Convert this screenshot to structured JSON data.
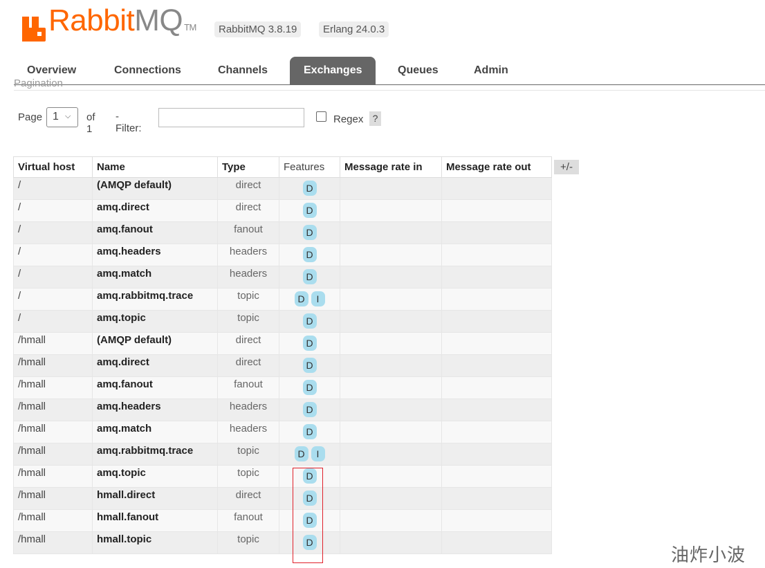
{
  "header": {
    "logo_rabbit": "Rabbit",
    "logo_mq": "MQ",
    "logo_tm": "TM",
    "version_badge": "RabbitMQ 3.8.19",
    "erlang_badge": "Erlang 24.0.3"
  },
  "tabs": [
    "Overview",
    "Connections",
    "Channels",
    "Exchanges",
    "Queues",
    "Admin"
  ],
  "active_tab": "Exchanges",
  "pagination": {
    "section_label": "Pagination",
    "page_label": "Page",
    "page_value": "1",
    "of_label": "of 1",
    "filter_label": "- Filter:",
    "filter_value": "",
    "regex_label": "Regex",
    "help_label": "?"
  },
  "table": {
    "columns": [
      "Virtual host",
      "Name",
      "Type",
      "Features",
      "Message rate in",
      "Message rate out"
    ],
    "toggle_label": "+/-",
    "rows": [
      {
        "vhost": "/",
        "name": "(AMQP default)",
        "type": "direct",
        "features": [
          "D"
        ]
      },
      {
        "vhost": "/",
        "name": "amq.direct",
        "type": "direct",
        "features": [
          "D"
        ]
      },
      {
        "vhost": "/",
        "name": "amq.fanout",
        "type": "fanout",
        "features": [
          "D"
        ]
      },
      {
        "vhost": "/",
        "name": "amq.headers",
        "type": "headers",
        "features": [
          "D"
        ]
      },
      {
        "vhost": "/",
        "name": "amq.match",
        "type": "headers",
        "features": [
          "D"
        ]
      },
      {
        "vhost": "/",
        "name": "amq.rabbitmq.trace",
        "type": "topic",
        "features": [
          "D",
          "I"
        ]
      },
      {
        "vhost": "/",
        "name": "amq.topic",
        "type": "topic",
        "features": [
          "D"
        ]
      },
      {
        "vhost": "/hmall",
        "name": "(AMQP default)",
        "type": "direct",
        "features": [
          "D"
        ]
      },
      {
        "vhost": "/hmall",
        "name": "amq.direct",
        "type": "direct",
        "features": [
          "D"
        ]
      },
      {
        "vhost": "/hmall",
        "name": "amq.fanout",
        "type": "fanout",
        "features": [
          "D"
        ]
      },
      {
        "vhost": "/hmall",
        "name": "amq.headers",
        "type": "headers",
        "features": [
          "D"
        ]
      },
      {
        "vhost": "/hmall",
        "name": "amq.match",
        "type": "headers",
        "features": [
          "D"
        ]
      },
      {
        "vhost": "/hmall",
        "name": "amq.rabbitmq.trace",
        "type": "topic",
        "features": [
          "D",
          "I"
        ]
      },
      {
        "vhost": "/hmall",
        "name": "amq.topic",
        "type": "topic",
        "features": [
          "D"
        ]
      },
      {
        "vhost": "/hmall",
        "name": "hmall.direct",
        "type": "direct",
        "features": [
          "D"
        ]
      },
      {
        "vhost": "/hmall",
        "name": "hmall.fanout",
        "type": "fanout",
        "features": [
          "D"
        ]
      },
      {
        "vhost": "/hmall",
        "name": "hmall.topic",
        "type": "topic",
        "features": [
          "D"
        ]
      }
    ]
  },
  "watermark": "油炸小波",
  "colors": {
    "brand": "#ff6600",
    "active_tab": "#666666",
    "pill": "#aaddee",
    "highlight": "#e0202a"
  }
}
